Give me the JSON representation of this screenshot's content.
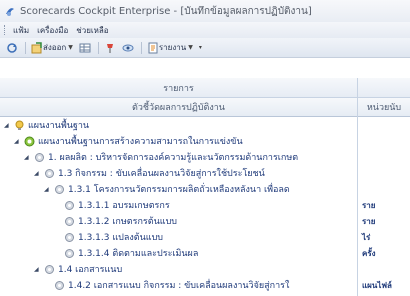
{
  "window": {
    "title": "Scorecards Cockpit Enterprise - [บันทึกข้อมูลผลการปฏิบัติงาน]"
  },
  "menu": [
    "แฟ้ม",
    "เครื่องมือ",
    "ช่วยเหลือ"
  ],
  "toolbar": {
    "export_label": "ส่งออก",
    "report_label": "รายงาน"
  },
  "grid": {
    "header_top": "รายการ",
    "header_indicator": "ตัวชี้วัดผลการปฏิบัติงาน",
    "header_unit": "หน่วยนับ",
    "rows": [
      {
        "label": "แผนงานพื้นฐาน",
        "unit": ""
      },
      {
        "label": "แผนงานพื้นฐานการสร้างความสามารถในการแข่งขัน",
        "unit": ""
      },
      {
        "label": "1. ผลผลิต : บริหารจัดการองค์ความรู้และนวัตกรรมด้านการเกษต",
        "unit": ""
      },
      {
        "label": "1.3 กิจกรรม : ขับเคลื่อนผลงานวิจัยสู่การใช้ประโยชน์",
        "unit": ""
      },
      {
        "label": "1.3.1 โครงการนวัตกรรมการผลิตถั่วเหลืองหลังนา เพื่อลด",
        "unit": ""
      },
      {
        "label": "1.3.1.1 อบรมเกษตรกร",
        "unit": "ราย"
      },
      {
        "label": "1.3.1.2 เกษตรกรต้นแบบ",
        "unit": "ราย"
      },
      {
        "label": "1.3.1.3 แปลงต้นแบบ",
        "unit": "ไร่"
      },
      {
        "label": "1.3.1.4 ติดตามและประเมินผล",
        "unit": "ครั้ง"
      },
      {
        "label": "1.4 เอกสารแนบ",
        "unit": ""
      },
      {
        "label": "1.4.2 เอกสารแนบ กิจกรรม : ขับเคลื่อนผลงานวิจัยสู่การใ",
        "unit": "แผนไฟล์"
      }
    ]
  }
}
